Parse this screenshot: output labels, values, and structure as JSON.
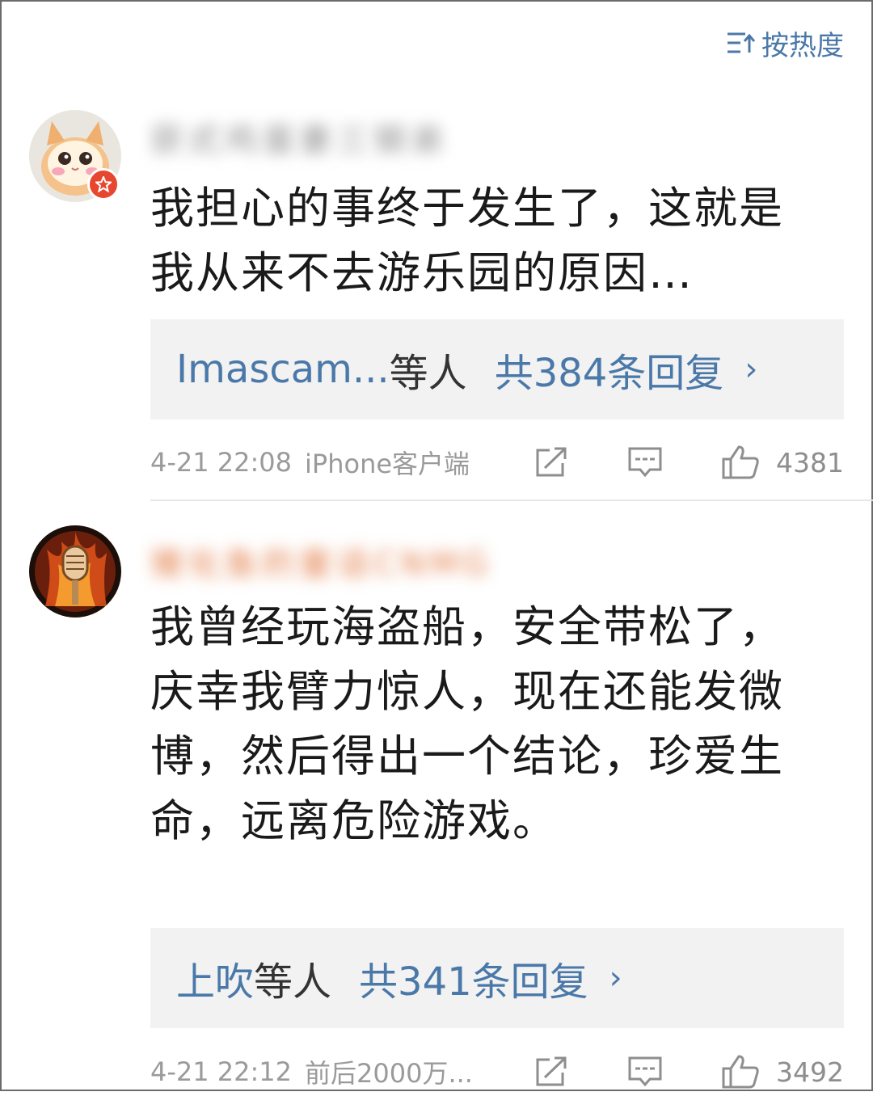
{
  "sort": {
    "label": "按热度",
    "icon": "sort-list-icon"
  },
  "comments": [
    {
      "username": "获式鸡蛋妻三钢弟",
      "avatar_icon": "cat-avatar",
      "badge_icon": "vip-star-badge",
      "text": "我担心的事终于发生了，这就是我从来不去游乐园的原因…",
      "replies": {
        "names": "Imascam...",
        "etal": "等人",
        "total": "共384条回复",
        "chevron": "›"
      },
      "time": "4-21 22:08",
      "source": "iPhone客户端",
      "likes": "4381"
    },
    {
      "username": "猪化鱼的童话CNMG",
      "avatar_icon": "microphone-fire-avatar",
      "text": "我曾经玩海盗船，安全带松了，庆幸我臂力惊人，现在还能发微博，然后得出一个结论，珍爱生命，远离危险游戏。",
      "replies": {
        "names": "上吹",
        "etal": "等人",
        "total": "共341条回复",
        "chevron": "›"
      },
      "time": "4-21 22:12",
      "source": "前后2000万...",
      "likes": "3492"
    }
  ],
  "colors": {
    "link": "#4a78a8",
    "meta": "#9a9a9a",
    "reply_bg": "#f2f2f2",
    "badge": "#e8472f"
  }
}
